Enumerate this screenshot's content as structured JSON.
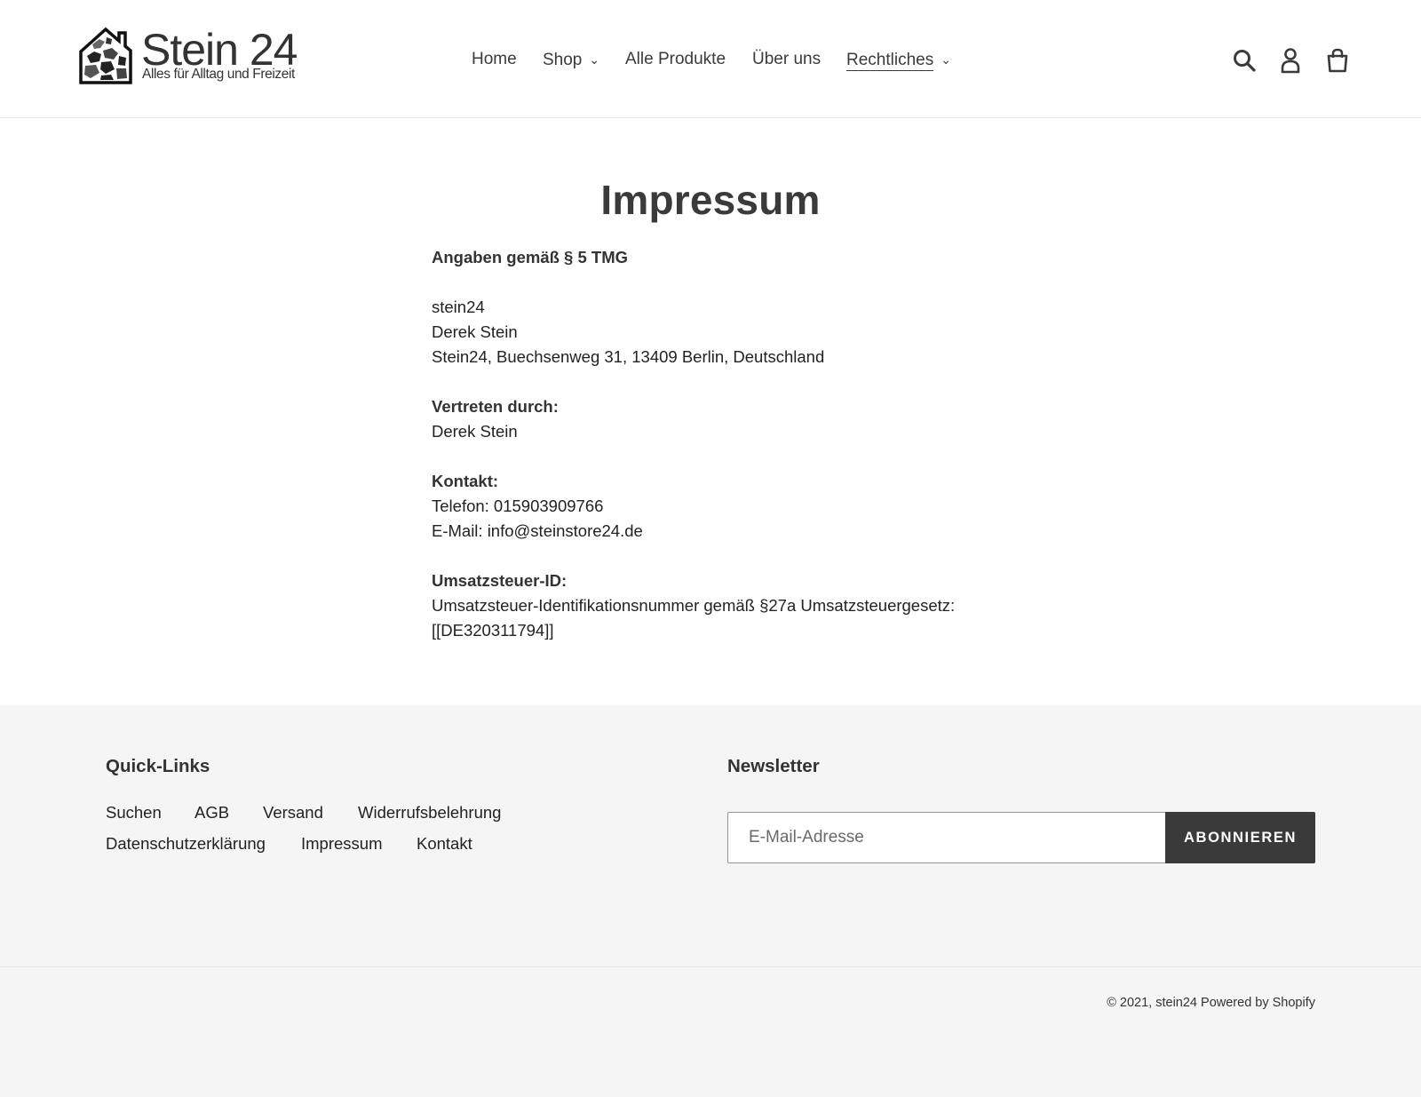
{
  "header": {
    "logo": {
      "title": "Stein 24",
      "tagline": "Alles für Alltag und Freizeit"
    },
    "nav": [
      {
        "label": "Home",
        "has_dropdown": false
      },
      {
        "label": "Shop",
        "has_dropdown": true
      },
      {
        "label": "Alle Produkte",
        "has_dropdown": false
      },
      {
        "label": "Über uns",
        "has_dropdown": false
      },
      {
        "label": "Rechtliches",
        "has_dropdown": true,
        "active": true
      }
    ],
    "icons": [
      "search-icon",
      "account-icon",
      "cart-icon"
    ]
  },
  "main": {
    "title": "Impressum",
    "section1_heading": "Angaben gemäß § 5 TMG",
    "company": "stein24",
    "owner": "Derek Stein",
    "address": "Stein24, Buechsenweg 31, 13409 Berlin, Deutschland",
    "represented_heading": "Vertreten durch:",
    "represented_name": "Derek Stein",
    "contact_heading": "Kontakt:",
    "phone": "Telefon: 015903909766",
    "email": "E-Mail: info@steinstore24.de",
    "vat_heading": "Umsatzsteuer-ID:",
    "vat_text": "Umsatzsteuer-Identifikationsnummer gemäß §27a Umsatzsteuergesetz:",
    "vat_id": "[[DE320311794]]"
  },
  "footer": {
    "quick_links_heading": "Quick-Links",
    "quick_links": [
      "Suchen",
      "AGB",
      "Versand",
      "Widerrufsbelehrung",
      "Datenschutzerklärung",
      "Impressum",
      "Kontakt"
    ],
    "newsletter_heading": "Newsletter",
    "newsletter_placeholder": "E-Mail-Adresse",
    "newsletter_button": "ABONNIEREN",
    "copyright_prefix": "© 2021,",
    "copyright_store": "stein24",
    "powered_by": "Powered by Shopify"
  },
  "colors": {
    "text": "#3a3a3a",
    "footer_bg": "#f5f5f5",
    "button_bg": "#3a3a3a",
    "button_text": "#ffffff"
  }
}
